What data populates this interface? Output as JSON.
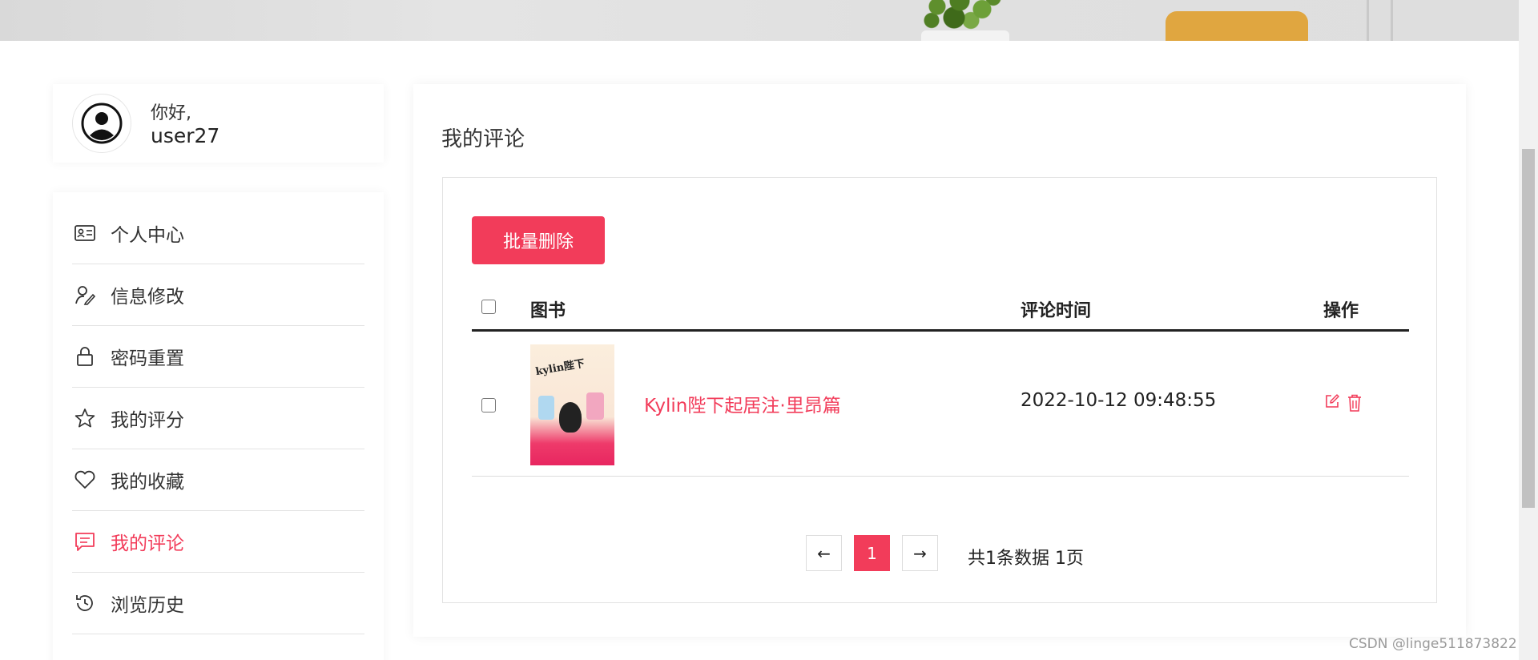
{
  "user": {
    "greeting": "你好,",
    "username": "user27"
  },
  "sidebar": {
    "items": [
      {
        "label": "个人中心",
        "icon": "id-card-icon"
      },
      {
        "label": "信息修改",
        "icon": "user-edit-icon"
      },
      {
        "label": "密码重置",
        "icon": "lock-icon"
      },
      {
        "label": "我的评分",
        "icon": "star-icon"
      },
      {
        "label": "我的收藏",
        "icon": "heart-icon"
      },
      {
        "label": "我的评论",
        "icon": "comment-icon",
        "active": true
      },
      {
        "label": "浏览历史",
        "icon": "history-icon"
      }
    ]
  },
  "main": {
    "title": "我的评论",
    "batch_delete_label": "批量删除",
    "table": {
      "headers": [
        "图书",
        "评论时间",
        "操作"
      ],
      "rows": [
        {
          "book_title": "Kylin陛下起居注·里昂篇",
          "time": "2022-10-12 09:48:55",
          "actions": [
            "edit-icon",
            "trash-icon"
          ]
        }
      ]
    },
    "pagination": {
      "prev": "←",
      "current": "1",
      "next": "→",
      "info": "共1条数据  1页"
    }
  },
  "watermark": "CSDN @linge511873822",
  "colors": {
    "accent": "#f23c5a",
    "text": "#222222"
  }
}
